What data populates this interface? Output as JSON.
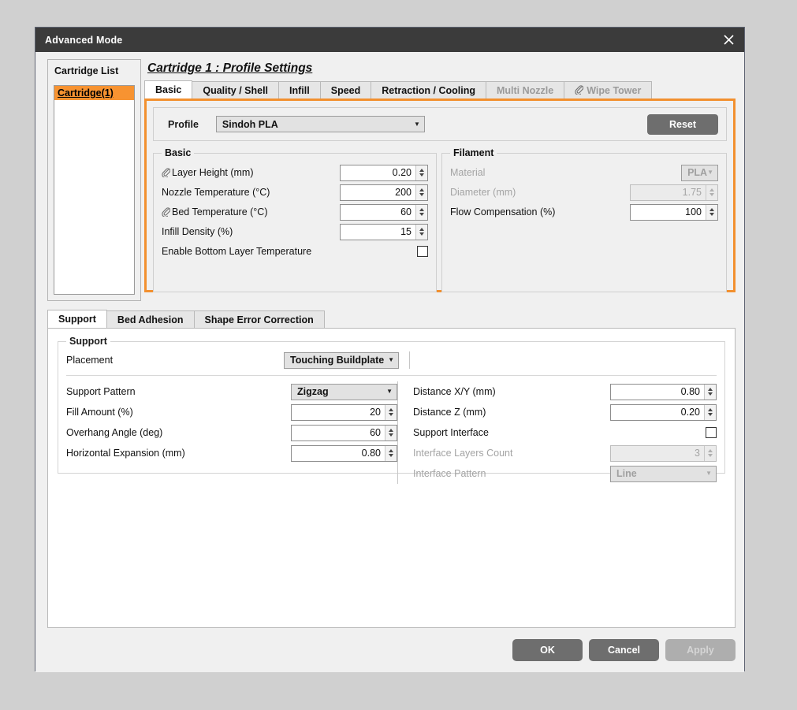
{
  "window": {
    "title": "Advanced Mode",
    "close_label": "×"
  },
  "cartridge_list": {
    "title": "Cartridge List",
    "items": [
      {
        "label": "Cartridge(1)",
        "selected": true
      }
    ]
  },
  "profile_settings": {
    "heading": "Cartridge 1 : Profile Settings",
    "tabs": [
      {
        "label": "Basic",
        "active": true,
        "disabled": false,
        "icon": ""
      },
      {
        "label": "Quality / Shell",
        "active": false,
        "disabled": false,
        "icon": ""
      },
      {
        "label": "Infill",
        "active": false,
        "disabled": false,
        "icon": ""
      },
      {
        "label": "Speed",
        "active": false,
        "disabled": false,
        "icon": ""
      },
      {
        "label": "Retraction / Cooling",
        "active": false,
        "disabled": false,
        "icon": ""
      },
      {
        "label": "Multi Nozzle",
        "active": false,
        "disabled": true,
        "icon": ""
      },
      {
        "label": "Wipe Tower",
        "active": false,
        "disabled": true,
        "icon": "paperclip-icon"
      }
    ],
    "profile": {
      "label": "Profile",
      "value": "Sindoh PLA",
      "arrow": "▼"
    },
    "reset_label": "Reset",
    "basic_group": {
      "legend": "Basic",
      "fields": [
        {
          "label": "Layer Height (mm)",
          "value": "0.20",
          "icon": "paperclip-icon",
          "type": "spinner",
          "disabled": false
        },
        {
          "label": "Nozzle Temperature (°C)",
          "value": "200",
          "icon": "",
          "type": "spinner",
          "disabled": false
        },
        {
          "label": "Bed Temperature (°C)",
          "value": "60",
          "icon": "paperclip-icon",
          "type": "spinner",
          "disabled": false
        },
        {
          "label": "Infill Density (%)",
          "value": "15",
          "icon": "",
          "type": "spinner",
          "disabled": false
        },
        {
          "label": "Enable Bottom Layer Temperature",
          "value": "",
          "icon": "",
          "type": "checkbox",
          "checked": false,
          "disabled": false
        }
      ]
    },
    "filament_group": {
      "legend": "Filament",
      "fields": [
        {
          "label": "Material",
          "value": "PLA",
          "type": "combo",
          "disabled": true,
          "arrow": "▼"
        },
        {
          "label": "Diameter (mm)",
          "value": "1.75",
          "type": "spinner",
          "disabled": true
        },
        {
          "label": "Flow Compensation (%)",
          "value": "100",
          "type": "spinner",
          "disabled": false
        }
      ]
    }
  },
  "lower_section": {
    "tabs": [
      {
        "label": "Support",
        "active": true
      },
      {
        "label": "Bed Adhesion",
        "active": false
      },
      {
        "label": "Shape Error Correction",
        "active": false
      }
    ],
    "support_group": {
      "legend": "Support",
      "placement": {
        "label": "Placement",
        "value": "Touching Buildplate",
        "arrow": "▼"
      },
      "left_fields": [
        {
          "label": "Support Pattern",
          "value": "Zigzag",
          "type": "combo",
          "disabled": false,
          "arrow": "▼"
        },
        {
          "label": "Fill Amount (%)",
          "value": "20",
          "type": "spinner",
          "disabled": false
        },
        {
          "label": "Overhang Angle (deg)",
          "value": "60",
          "type": "spinner",
          "disabled": false
        },
        {
          "label": "Horizontal Expansion (mm)",
          "value": "0.80",
          "type": "spinner",
          "disabled": false
        }
      ],
      "right_fields": [
        {
          "label": "Distance X/Y (mm)",
          "value": "0.80",
          "type": "spinner",
          "disabled": false
        },
        {
          "label": "Distance Z (mm)",
          "value": "0.20",
          "type": "spinner",
          "disabled": false
        },
        {
          "label": "Support Interface",
          "value": "",
          "type": "checkbox",
          "checked": false,
          "disabled": false
        },
        {
          "label": "Interface Layers Count",
          "value": "3",
          "type": "spinner",
          "disabled": true
        },
        {
          "label": "Interface Pattern",
          "value": "Line",
          "type": "combo",
          "disabled": true,
          "arrow": "▼"
        }
      ]
    }
  },
  "footer": {
    "ok_label": "OK",
    "cancel_label": "Cancel",
    "apply_label": "Apply",
    "apply_disabled": true
  },
  "colors": {
    "accent_orange": "#f2902f",
    "selection_orange": "#f79331",
    "titlebar": "#3b3b3b",
    "button_grey": "#6e6e6e",
    "desktop": "#d0d0d0"
  }
}
